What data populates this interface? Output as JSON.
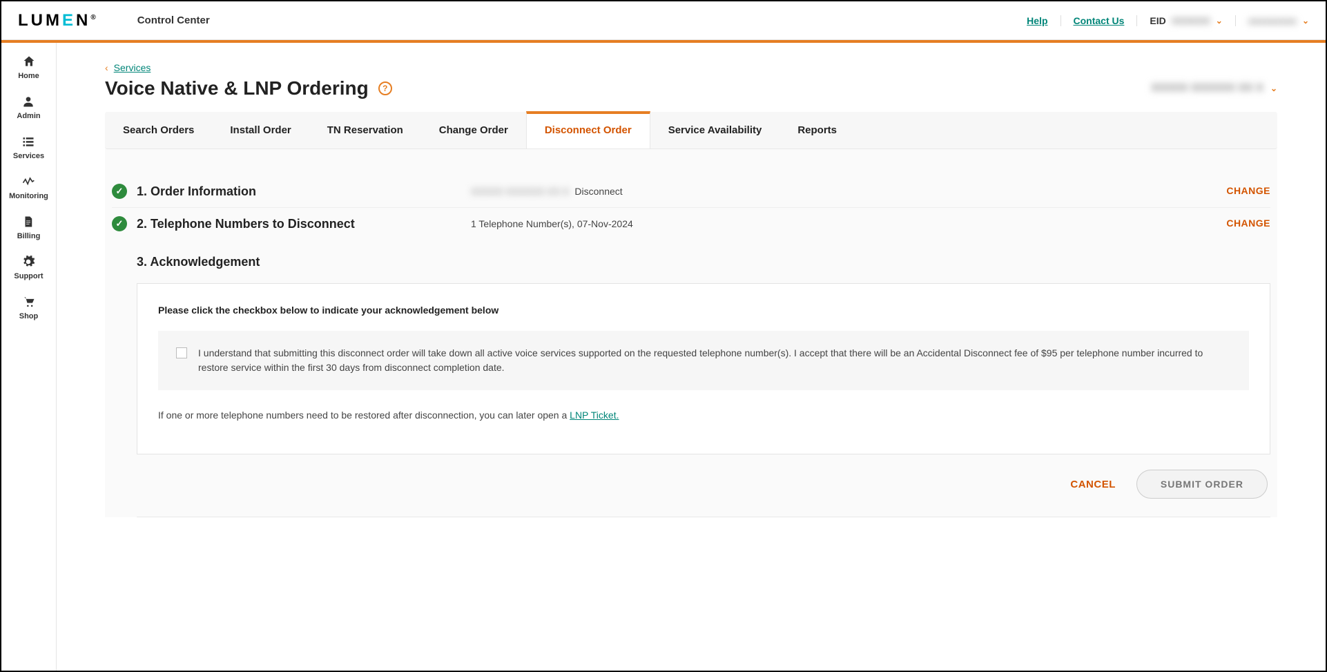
{
  "header": {
    "logo_text": "LUMEN",
    "app_title": "Control Center",
    "help_label": "Help",
    "contact_label": "Contact Us",
    "eid_label": "EID",
    "eid_value": "XXXXXX",
    "account_value": "xxxxxxxxx"
  },
  "sidebar": {
    "items": [
      {
        "icon": "home-icon",
        "label": "Home"
      },
      {
        "icon": "user-icon",
        "label": "Admin"
      },
      {
        "icon": "list-icon",
        "label": "Services"
      },
      {
        "icon": "activity-icon",
        "label": "Monitoring"
      },
      {
        "icon": "file-icon",
        "label": "Billing"
      },
      {
        "icon": "gear-icon",
        "label": "Support"
      },
      {
        "icon": "cart-icon",
        "label": "Shop"
      }
    ]
  },
  "breadcrumb": {
    "parent": "Services"
  },
  "page": {
    "title": "Voice Native & LNP Ordering",
    "account_selector": "XXXXX XXXXXX XX X"
  },
  "tabs": [
    {
      "label": "Search Orders",
      "active": false
    },
    {
      "label": "Install Order",
      "active": false
    },
    {
      "label": "TN Reservation",
      "active": false
    },
    {
      "label": "Change Order",
      "active": false
    },
    {
      "label": "Disconnect Order",
      "active": true
    },
    {
      "label": "Service Availability",
      "active": false
    },
    {
      "label": "Reports",
      "active": false
    }
  ],
  "steps": {
    "s1": {
      "title": "1. Order Information",
      "summary_account": "XXXXX XXXXXX XX X",
      "summary_type": "Disconnect",
      "change_label": "CHANGE"
    },
    "s2": {
      "title": "2. Telephone Numbers to Disconnect",
      "summary": "1 Telephone Number(s), 07-Nov-2024",
      "change_label": "CHANGE"
    },
    "s3": {
      "title": "3. Acknowledgement",
      "intro": "Please click the checkbox below to indicate your acknowledgement below",
      "ack_text": "I understand that submitting this disconnect order will take down all active voice services supported on the requested telephone number(s). I accept that there will be an Accidental Disconnect fee of $95 per telephone number incurred to restore service within the first 30 days from disconnect completion date.",
      "restore_prefix": "If one or more telephone numbers need to be restored after disconnection, you can later open a ",
      "restore_link": "LNP Ticket."
    }
  },
  "actions": {
    "cancel": "CANCEL",
    "submit": "SUBMIT ORDER"
  }
}
